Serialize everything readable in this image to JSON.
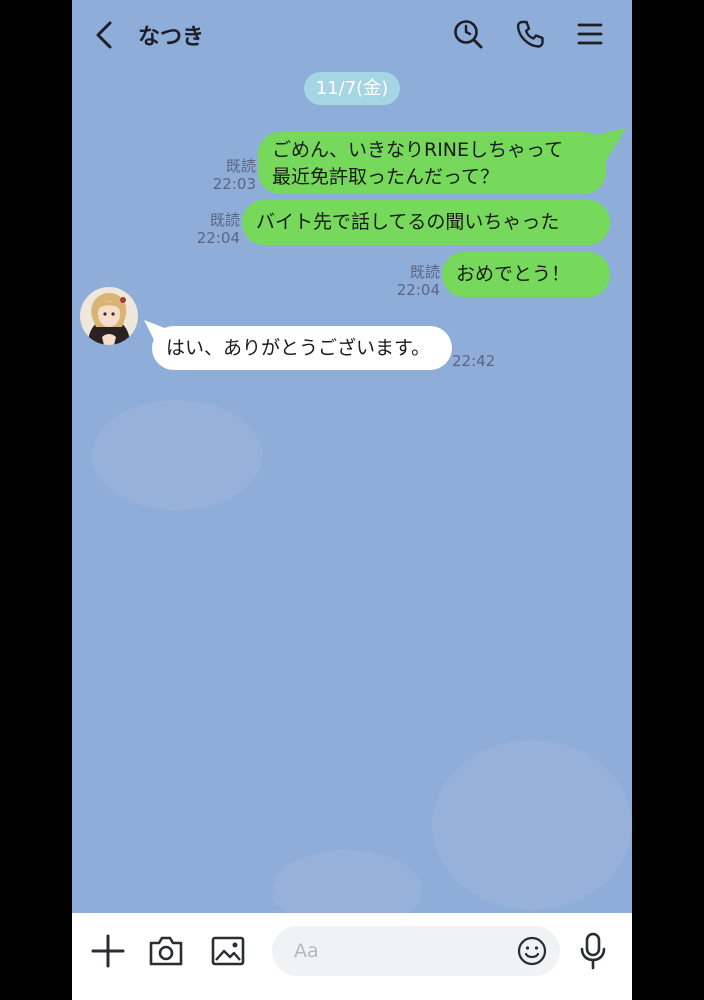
{
  "header": {
    "title": "なつき",
    "icons": [
      "back-arrow",
      "search-clock",
      "phone",
      "hamburger-menu"
    ]
  },
  "chat": {
    "date": "11/7(金)",
    "messages": [
      {
        "direction": "out",
        "lines": [
          "ごめん、いきなりRINEしちゃって",
          "最近免許取ったんだって？"
        ],
        "read": "既読",
        "time": "22:03"
      },
      {
        "direction": "out",
        "lines": [
          "バイト先で話してるの聞いちゃった"
        ],
        "read": "既読",
        "time": "22:04"
      },
      {
        "direction": "out",
        "lines": [
          "おめでとう！"
        ],
        "read": "既読",
        "time": "22:04"
      },
      {
        "direction": "in",
        "lines": [
          "はい、ありがとうございます。"
        ],
        "time": "22:42"
      }
    ]
  },
  "input_bar": {
    "placeholder": "Aa",
    "icons": [
      "plus",
      "camera",
      "image",
      "emoji",
      "microphone"
    ]
  },
  "colors": {
    "chat_background": "#8eadd9",
    "outgoing_bubble": "#76d95c",
    "incoming_bubble": "#ffffff",
    "date_pill": "#a6d6e3"
  }
}
